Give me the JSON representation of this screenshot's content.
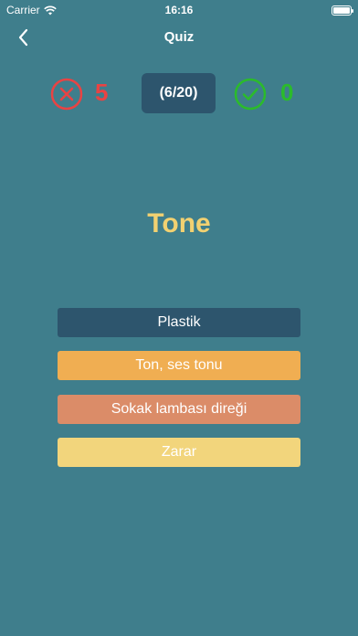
{
  "status_bar": {
    "carrier": "Carrier",
    "time": "16:16"
  },
  "nav": {
    "title": "Quiz",
    "back_icon": "chevron-left-icon"
  },
  "score": {
    "wrong": "5",
    "progress": "(6/20)",
    "correct": "0",
    "wrong_color": "#e94343",
    "correct_color": "#2bbb2b"
  },
  "question": {
    "word": "Tone"
  },
  "answers": [
    {
      "label": "Plastik",
      "color": "#2d556d"
    },
    {
      "label": "Ton, ses tonu",
      "color": "#f0ae52"
    },
    {
      "label": "Sokak lambası direği",
      "color": "#db8c68"
    },
    {
      "label": "Zarar",
      "color": "#f2d57c"
    }
  ],
  "colors": {
    "background": "#3f7e8c",
    "word": "#f2d171"
  }
}
